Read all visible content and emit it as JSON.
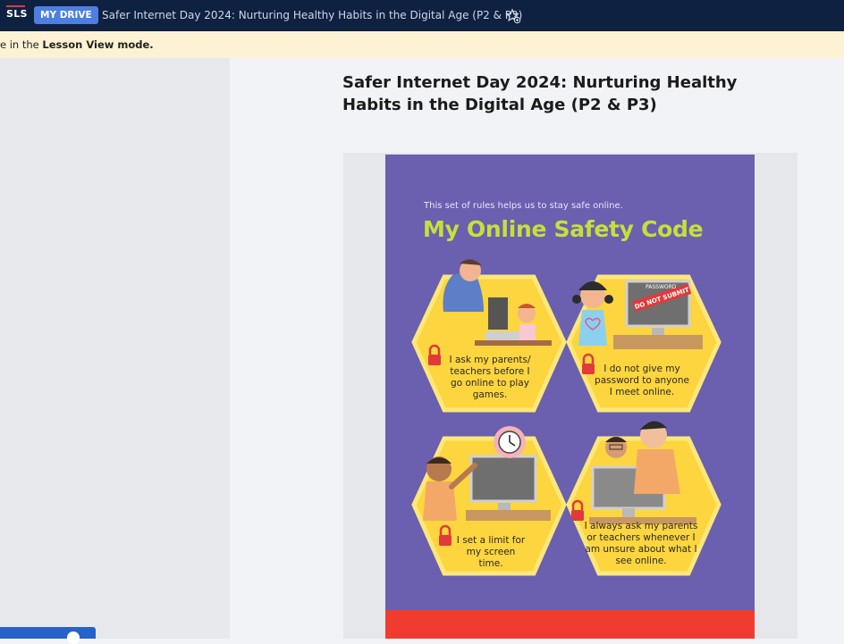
{
  "topbar": {
    "logo_text": "SLS",
    "drive_badge": "MY DRIVE",
    "lesson_title": "Safer Internet Day 2024: Nurturing Healthy Habits in the Digital Age (P2 & P3)",
    "star_icon": "star-add-icon"
  },
  "notice": {
    "prefix": "e in the ",
    "bold": "Lesson View mode."
  },
  "main": {
    "title": "Safer Internet Day 2024: Nurturing Healthy Habits in the Digital Age (P2 & P3)"
  },
  "poster": {
    "subtitle": "This set of rules helps us to stay safe online.",
    "heading": "My Online Safety Code",
    "stamp": "DO NOT SUBMIT",
    "password_label": "PASSWORD",
    "rules": [
      {
        "text": "I ask my parents/ teachers before I go online to play games."
      },
      {
        "text": "I do not give my password to anyone I meet online."
      },
      {
        "text": "I set a limit for my screen time."
      },
      {
        "text": "I always ask my parents or teachers whenever I am unsure about what I see online."
      }
    ]
  },
  "colors": {
    "topbar": "#0f2140",
    "drive_badge": "#4c7fe0",
    "notice_bg": "#fdf3d4",
    "poster_bg": "#6b5fb0",
    "poster_heading": "#c6e03a",
    "hex_fill": "#fcd53f",
    "poster_bottom": "#ef3b30"
  }
}
